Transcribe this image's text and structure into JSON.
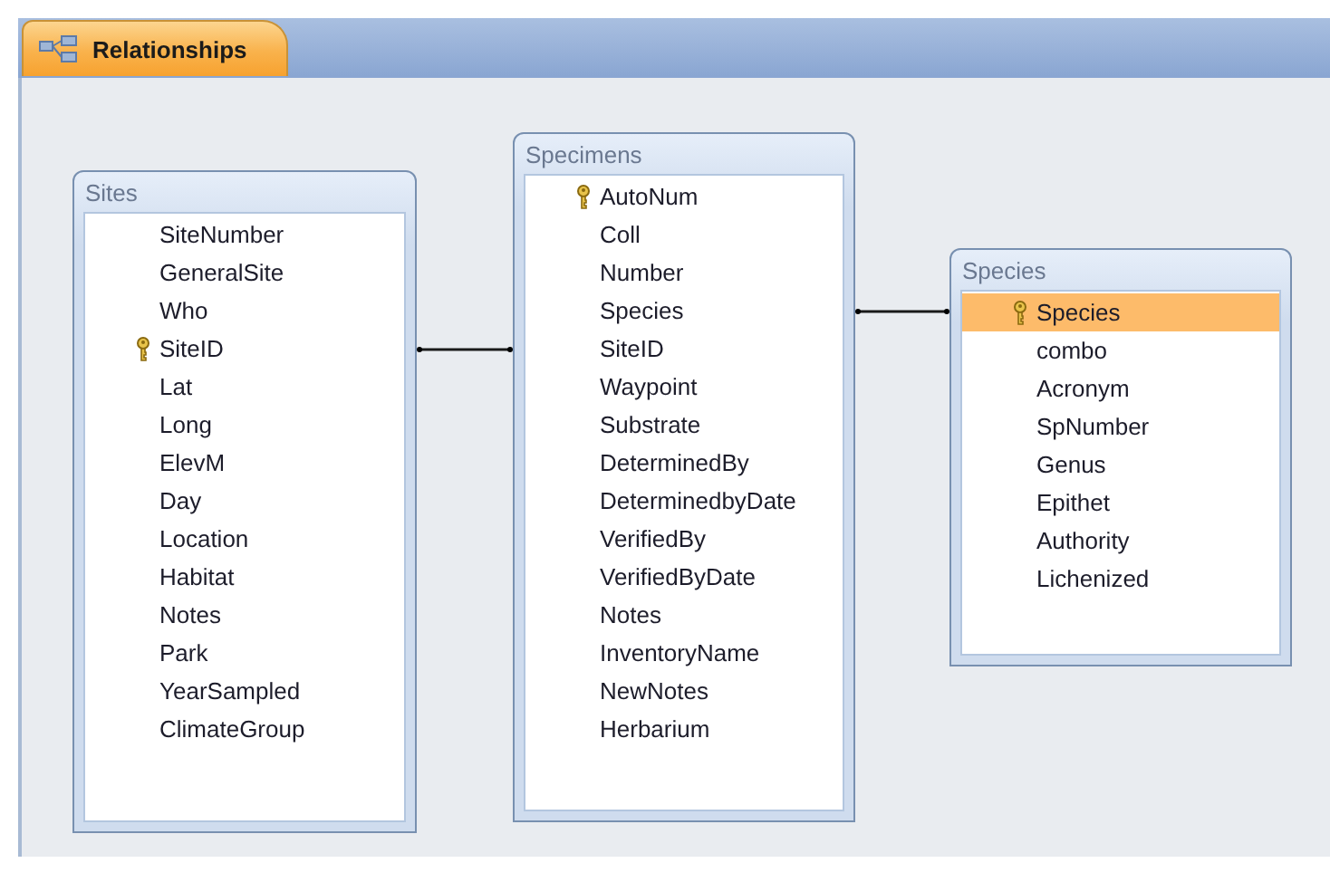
{
  "tab": {
    "label": "Relationships",
    "selected": true
  },
  "tables": [
    {
      "title": "Sites",
      "fields": [
        {
          "name": "SiteNumber",
          "key": false,
          "selected": false
        },
        {
          "name": "GeneralSite",
          "key": false,
          "selected": false
        },
        {
          "name": "Who",
          "key": false,
          "selected": false
        },
        {
          "name": "SiteID",
          "key": true,
          "selected": false
        },
        {
          "name": "Lat",
          "key": false,
          "selected": false
        },
        {
          "name": "Long",
          "key": false,
          "selected": false
        },
        {
          "name": "ElevM",
          "key": false,
          "selected": false
        },
        {
          "name": "Day",
          "key": false,
          "selected": false
        },
        {
          "name": "Location",
          "key": false,
          "selected": false
        },
        {
          "name": "Habitat",
          "key": false,
          "selected": false
        },
        {
          "name": "Notes",
          "key": false,
          "selected": false
        },
        {
          "name": "Park",
          "key": false,
          "selected": false
        },
        {
          "name": "YearSampled",
          "key": false,
          "selected": false
        },
        {
          "name": "ClimateGroup",
          "key": false,
          "selected": false
        }
      ]
    },
    {
      "title": "Specimens",
      "fields": [
        {
          "name": "AutoNum",
          "key": true,
          "selected": false
        },
        {
          "name": "Coll",
          "key": false,
          "selected": false
        },
        {
          "name": "Number",
          "key": false,
          "selected": false
        },
        {
          "name": "Species",
          "key": false,
          "selected": false
        },
        {
          "name": "SiteID",
          "key": false,
          "selected": false
        },
        {
          "name": "Waypoint",
          "key": false,
          "selected": false
        },
        {
          "name": "Substrate",
          "key": false,
          "selected": false
        },
        {
          "name": "DeterminedBy",
          "key": false,
          "selected": false
        },
        {
          "name": "DeterminedbyDate",
          "key": false,
          "selected": false
        },
        {
          "name": "VerifiedBy",
          "key": false,
          "selected": false
        },
        {
          "name": "VerifiedByDate",
          "key": false,
          "selected": false
        },
        {
          "name": "Notes",
          "key": false,
          "selected": false
        },
        {
          "name": "InventoryName",
          "key": false,
          "selected": false
        },
        {
          "name": "NewNotes",
          "key": false,
          "selected": false
        },
        {
          "name": "Herbarium",
          "key": false,
          "selected": false
        }
      ]
    },
    {
      "title": "Species",
      "fields": [
        {
          "name": "Species",
          "key": true,
          "selected": true
        },
        {
          "name": "combo",
          "key": false,
          "selected": false
        },
        {
          "name": "Acronym",
          "key": false,
          "selected": false
        },
        {
          "name": "SpNumber",
          "key": false,
          "selected": false
        },
        {
          "name": "Genus",
          "key": false,
          "selected": false
        },
        {
          "name": "Epithet",
          "key": false,
          "selected": false
        },
        {
          "name": "Authority",
          "key": false,
          "selected": false
        },
        {
          "name": "Lichenized",
          "key": false,
          "selected": false
        }
      ]
    }
  ]
}
